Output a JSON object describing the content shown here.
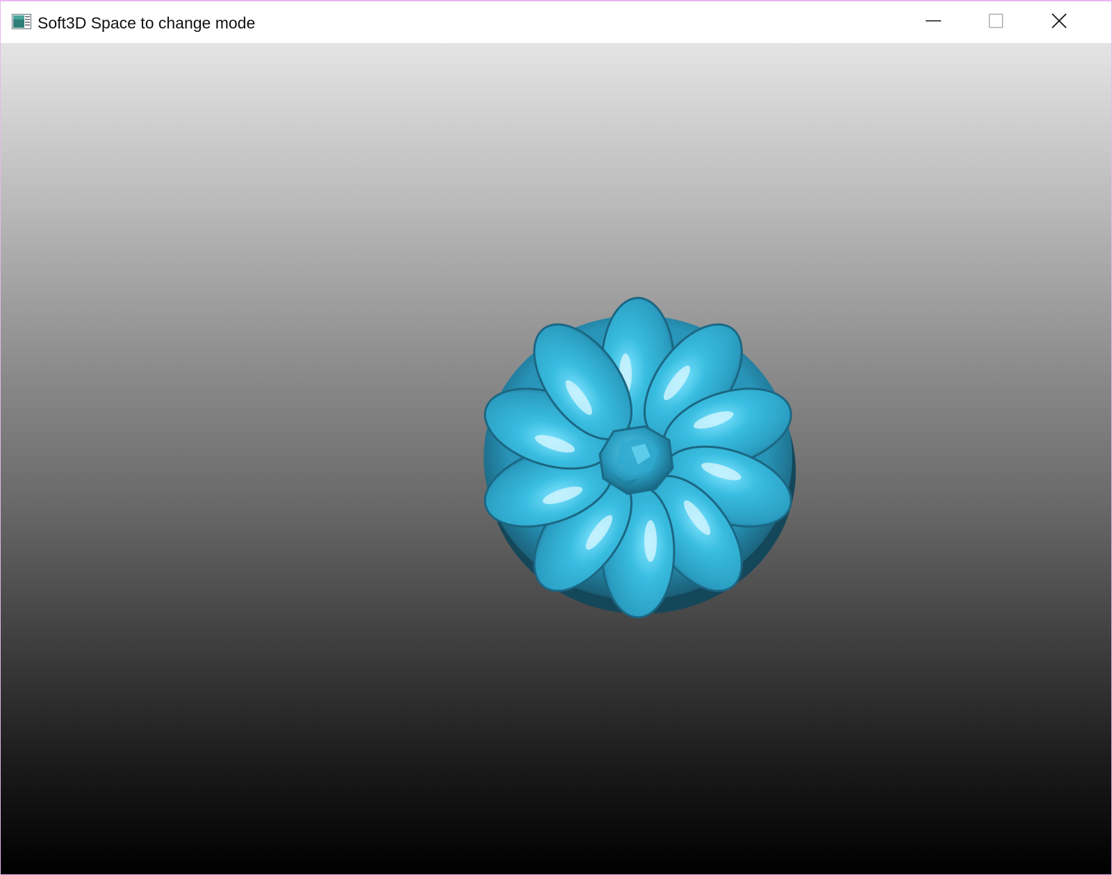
{
  "window": {
    "title": "Soft3D Space to change mode",
    "icon": "application-window-icon",
    "controls": {
      "minimize": "minimize-icon",
      "maximize": "maximize-icon",
      "close": "close-icon"
    }
  },
  "viewport": {
    "background": "vertical gradient from light gray to black",
    "gradient_top": "#e4e4e4",
    "gradient_bottom": "#000000",
    "model": {
      "object": "pumpkin",
      "color": "#38bde0",
      "shadow_color": "#14475a"
    }
  }
}
